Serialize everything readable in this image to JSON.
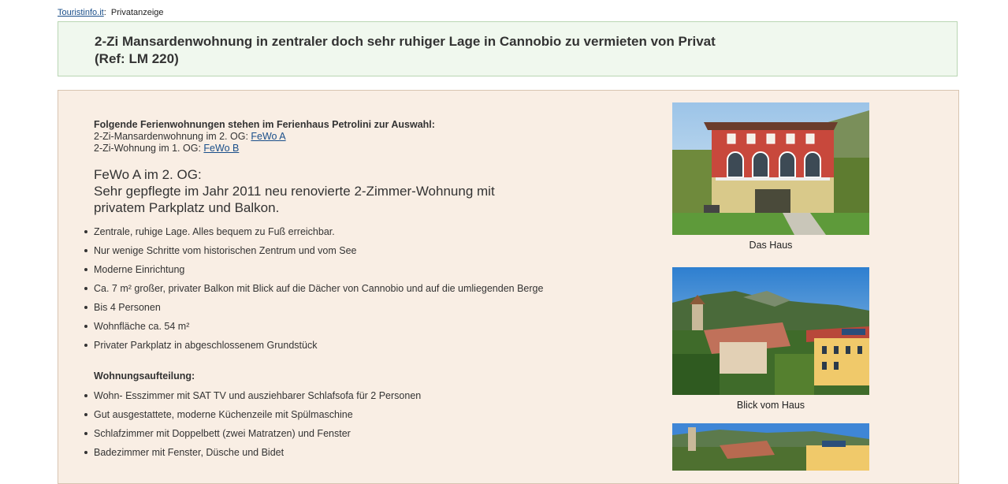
{
  "breadcrumb": {
    "site": "Touristinfo.it",
    "separator": ":",
    "current": "Privatanzeige"
  },
  "title": {
    "line1": "2-Zi Mansardenwohnung in zentraler doch sehr ruhiger Lage in Cannobio zu vermieten von Privat",
    "line2": "(Ref: LM 220)"
  },
  "intro": {
    "heading": "Folgende Ferienwohnungen stehen im Ferienhaus Petrolini zur Auswahl:",
    "row1_text": "2-Zi-Mansardenwohnung im 2. OG: ",
    "row1_link": "FeWo A",
    "row2_text": "2-Zi-Wohnung im 1. OG: ",
    "row2_link": "FeWo B"
  },
  "fewo": {
    "heading_line1": "FeWo A im 2. OG:",
    "heading_line2": "Sehr gepflegte im Jahr 2011 neu renovierte 2-Zimmer-Wohnung mit",
    "heading_line3": "privatem Parkplatz und Balkon.",
    "features": [
      "Zentrale, ruhige Lage. Alles bequem zu Fuß erreichbar.",
      "Nur wenige Schritte vom historischen Zentrum und vom See",
      "Moderne Einrichtung",
      "Ca. 7 m² großer, privater Balkon mit Blick auf die Dächer von Cannobio und auf die umliegenden Berge",
      "Bis 4 Personen",
      "Wohnfläche ca. 54 m²",
      "Privater Parkplatz in abgeschlossenem Grundstück"
    ]
  },
  "layout": {
    "heading": "Wohnungsaufteilung:",
    "items": [
      "Wohn- Esszimmer mit SAT TV und ausziehbarer Schlafsofa für 2 Personen",
      "Gut ausgestattete, moderne Küchenzeile mit Spülmaschine",
      "Schlafzimmer mit Doppelbett (zwei Matratzen) und Fenster",
      "Badezimmer mit Fenster, Düsche und Bidet"
    ]
  },
  "photos": [
    {
      "caption": "Das Haus"
    },
    {
      "caption": "Blick vom Haus"
    },
    {
      "caption": ""
    }
  ]
}
